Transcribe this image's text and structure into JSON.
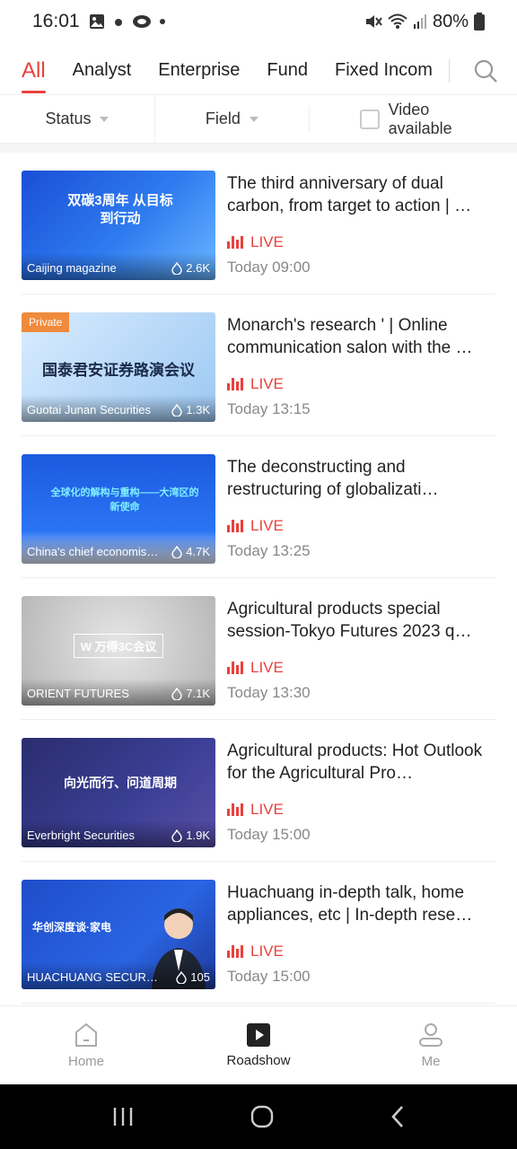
{
  "status_bar": {
    "time": "16:01",
    "battery": "80%"
  },
  "tabs": [
    {
      "label": "All",
      "active": true
    },
    {
      "label": "Analyst"
    },
    {
      "label": "Enterprise"
    },
    {
      "label": "Fund"
    },
    {
      "label": "Fixed Incom"
    }
  ],
  "filters": {
    "status": "Status",
    "field": "Field",
    "video_available": "Video available"
  },
  "items": [
    {
      "title": "The third anniversary of dual carbon, from target to action | …",
      "org": "Caijing magazine",
      "views": "2.6K",
      "status": "LIVE",
      "time": "Today 09:00",
      "thumb_text": "双碳3周年 从目标到行动",
      "private": ""
    },
    {
      "title": "Monarch's research ' | Online communication salon with the …",
      "org": "Guotai Junan Securities",
      "views": "1.3K",
      "status": "LIVE",
      "time": "Today 13:15",
      "thumb_text": "国泰君安证券路演会议",
      "private": "Private"
    },
    {
      "title": "The deconstructing and restructuring of globalizati…",
      "org": "China's chief economis…",
      "views": "4.7K",
      "status": "LIVE",
      "time": "Today 13:25",
      "thumb_text": "全球化的解构与重构——大湾区的新使命",
      "private": ""
    },
    {
      "title": "Agricultural products special session-Tokyo Futures 2023 q…",
      "org": "ORIENT FUTURES",
      "views": "7.1K",
      "status": "LIVE",
      "time": "Today 13:30",
      "thumb_text": "W 万得3C会议",
      "private": ""
    },
    {
      "title": "Agricultural products: Hot Outlook for the Agricultural Pro…",
      "org": "Everbright Securities",
      "views": "1.9K",
      "status": "LIVE",
      "time": "Today 15:00",
      "thumb_text": "向光而行、问道周期",
      "private": ""
    },
    {
      "title": "Huachuang in-depth talk, home appliances, etc | In-depth rese…",
      "org": "HUACHUANG SECURITI…",
      "views": "105",
      "status": "LIVE",
      "time": "Today 15:00",
      "thumb_text": "华创深度谈·家电",
      "private": ""
    }
  ],
  "bottom_nav": [
    {
      "label": "Home",
      "icon": "home-icon"
    },
    {
      "label": "Roadshow",
      "icon": "play-icon",
      "active": true
    },
    {
      "label": "Me",
      "icon": "person-icon"
    }
  ],
  "colors": {
    "accent": "#e8413c",
    "private_tag": "#f08a3c"
  }
}
